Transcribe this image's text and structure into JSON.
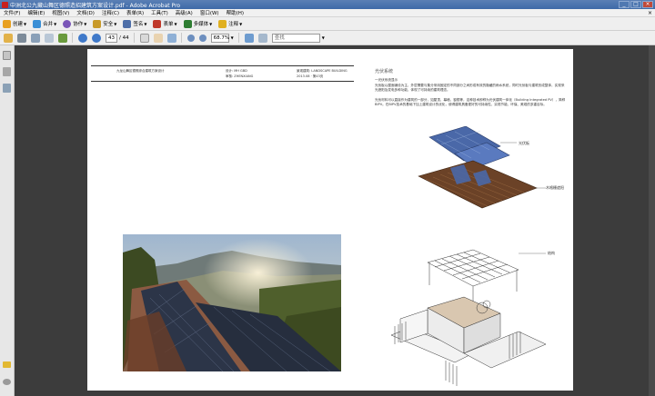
{
  "window": {
    "title": "中洲北公九藏山舞区德照造招建筑方案设计.pdf - Adobe Acrobat Pro",
    "minimize": "_",
    "maximize": "□",
    "close": "×"
  },
  "menubar": {
    "items": [
      "文件(F)",
      "编辑(E)",
      "视图(V)",
      "文档(D)",
      "注释(C)",
      "表单(R)",
      "工具(T)",
      "高级(A)",
      "窗口(W)",
      "帮助(H)"
    ],
    "close_glyph": "×"
  },
  "toolbar": {
    "buttons": [
      {
        "label": "创建",
        "icon": "create-icon",
        "color": "#e8a020"
      },
      {
        "label": "合并",
        "icon": "combine-icon",
        "color": "#3a8fd6"
      },
      {
        "label": "协作",
        "icon": "collaborate-icon",
        "color": "#7a56b8"
      },
      {
        "label": "安全",
        "icon": "lock-icon",
        "color": "#c89a2a"
      },
      {
        "label": "签名",
        "icon": "sign-icon",
        "color": "#4d6ea8"
      },
      {
        "label": "表单",
        "icon": "form-icon",
        "color": "#c0392b"
      },
      {
        "label": "多媒体",
        "icon": "multimedia-icon",
        "color": "#2e7d32"
      },
      {
        "label": "注释",
        "icon": "comment-icon",
        "color": "#e0b020"
      }
    ]
  },
  "nav": {
    "page_current": "43",
    "page_total": "/ 44",
    "zoom": "68.7%",
    "search_placeholder": "查找"
  },
  "document": {
    "header": {
      "project": "九龙山舞区德照综合建筑方案设计",
      "designer_label": "设计: MH GBD",
      "designer_sub": "审核: ZHENXIANG",
      "company": "景观建筑: LANDSCAPE BUILDING",
      "date": "2013.08 · 第43页"
    },
    "section_title": "光伏系统",
    "para1_title": "一光伏系统显示",
    "para1": "光伏板以屋面铺设为主，外层需要与集分采用固定的不同部分之间形成有效的隐藏的雨水系统，同时光伏板与建筑形成整体，实现采光遮阳及发电多种功能，体现了可持续的建筑理念。",
    "para2": "光伏材料可以直接作为建筑的一部分，如屋顶、幕墙、窗檐等，这种技术即称为光伏建筑一体化（Building Integrated PV），简称BIPV。在BIPV技术的基础下加上建筑设计的优化，使得建筑具备更好的可持续性，实现节能、环保、美观的多重目标。",
    "labels": {
      "pv": "光伏板",
      "wood": "木格栅遮阳",
      "structure": "结构"
    }
  }
}
